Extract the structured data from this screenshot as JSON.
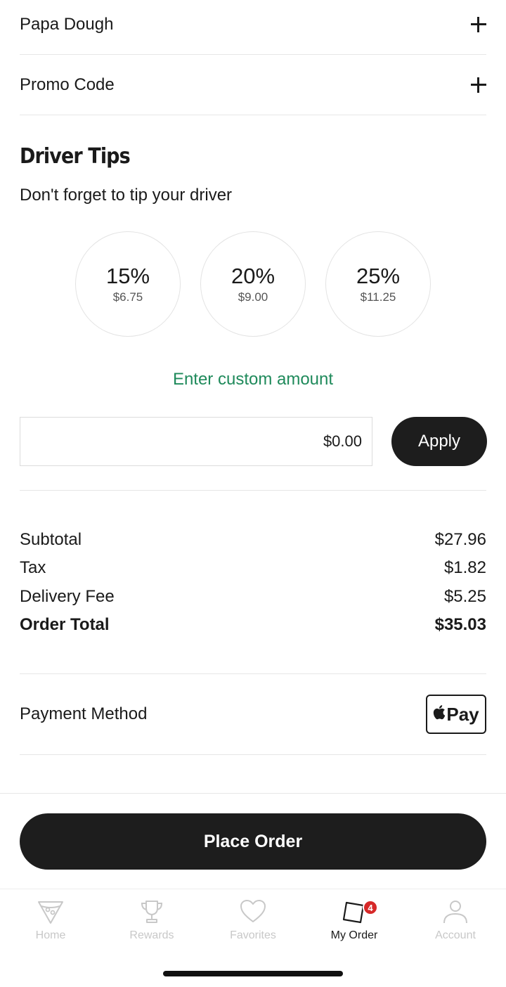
{
  "sections": {
    "papa_dough": "Papa Dough",
    "promo_code": "Promo Code"
  },
  "tips": {
    "title": "Driver Tips",
    "subtitle": "Don't forget to tip your driver",
    "options": [
      {
        "percent": "15%",
        "amount": "$6.75"
      },
      {
        "percent": "20%",
        "amount": "$9.00"
      },
      {
        "percent": "25%",
        "amount": "$11.25"
      }
    ],
    "custom_link": "Enter custom amount",
    "custom_value": "$0.00",
    "apply_label": "Apply"
  },
  "summary": {
    "subtotal_label": "Subtotal",
    "subtotal_value": "$27.96",
    "tax_label": "Tax",
    "tax_value": "$1.82",
    "delivery_label": "Delivery Fee",
    "delivery_value": "$5.25",
    "total_label": "Order Total",
    "total_value": "$35.03"
  },
  "payment": {
    "label": "Payment Method",
    "method": "Pay",
    "method_icon": "apple-logo-icon"
  },
  "place_order_label": "Place Order",
  "tabbar": {
    "home": "Home",
    "rewards": "Rewards",
    "favorites": "Favorites",
    "my_order": "My Order",
    "my_order_badge": "4",
    "account": "Account"
  },
  "colors": {
    "accent_green": "#1f8a5b",
    "button_dark": "#1d1d1d",
    "badge_red": "#d62828"
  }
}
